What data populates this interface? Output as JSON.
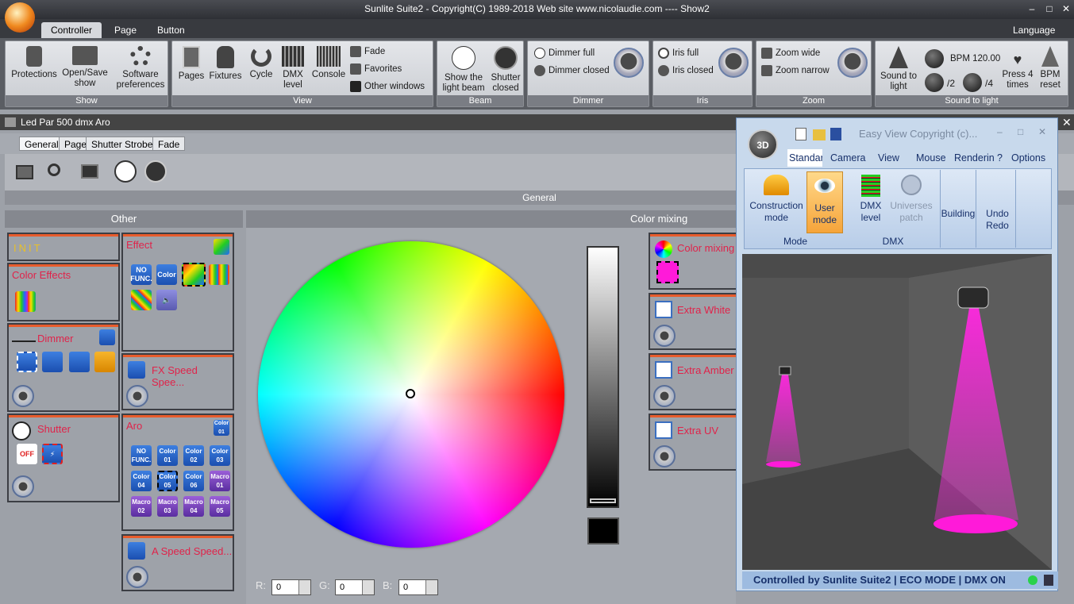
{
  "window": {
    "title": "Sunlite Suite2 - Copyright(C) 1989-2018   Web site www.nicolaudie.com ---- Show2",
    "language": "Language"
  },
  "ribbon_tabs": [
    "Controller",
    "Page",
    "Button"
  ],
  "groups": {
    "show": {
      "label": "Show",
      "protections": "Protections",
      "open_save": "Open/Save\nshow",
      "software_prefs": "Software\npreferences"
    },
    "view": {
      "label": "View",
      "pages": "Pages",
      "fixtures": "Fixtures",
      "cycle": "Cycle",
      "dmx_level": "DMX\nlevel",
      "console": "Console",
      "fade": "Fade",
      "favorites": "Favorites",
      "other_windows": "Other windows"
    },
    "beam": {
      "label": "Beam",
      "show_light_beam": "Show the\nlight beam",
      "shutter_closed": "Shutter\nclosed"
    },
    "dimmer": {
      "label": "Dimmer",
      "full": "Dimmer full",
      "closed": "Dimmer closed"
    },
    "iris": {
      "label": "Iris",
      "full": "Iris full",
      "closed": "Iris closed"
    },
    "zoom": {
      "label": "Zoom",
      "wide": "Zoom wide",
      "narrow": "Zoom narrow"
    },
    "sound": {
      "label": "Sound to light",
      "sound_to_light": "Sound to\nlight",
      "bpm": "BPM 120.00",
      "div2": "/2",
      "div4": "/4",
      "press4": "Press 4\ntimes",
      "bpm_reset": "BPM\nreset"
    }
  },
  "fixture": {
    "name": "Led Par 500 dmx Aro"
  },
  "subtabs": [
    "General",
    "Page",
    "Shutter Strobe",
    "Fade"
  ],
  "headers": {
    "general": "General",
    "other": "Other",
    "color_mixing": "Color mixing"
  },
  "panels": {
    "init": "INIT",
    "color_effects": "Color Effects",
    "dimmer": "Dimmer",
    "shutter": "Shutter",
    "effect": "Effect",
    "fx_speed": "FX Speed Spee...",
    "aro": "Aro",
    "a_speed": "A Speed Speed...",
    "color_mixing": "Color mixing",
    "extra_white": "Extra White",
    "extra_amber": "Extra Amber",
    "extra_uv": "Extra UV"
  },
  "effect_buttons": [
    "NO\nFUNC.",
    "Color",
    "",
    "",
    "",
    ""
  ],
  "aro_buttons": [
    "NO\nFUNC.",
    "Color\n01",
    "Color\n02",
    "Color\n03",
    "Color\n04",
    "Color\n05",
    "Color\n06",
    "Macro\n01",
    "Macro\n02",
    "Macro\n03",
    "Macro\n04",
    "Macro\n05"
  ],
  "aro_badge": "Color\n01",
  "shutter_off": "OFF",
  "rgb": {
    "r_label": "R:",
    "g_label": "G:",
    "b_label": "B:",
    "r": "0",
    "g": "0",
    "b": "0"
  },
  "easyview": {
    "title": "Easy View   Copyright (c)...",
    "tabs": [
      "Standard",
      "Camera",
      "View",
      "Mouse",
      "Renderin"
    ],
    "options": "Options",
    "help": "?",
    "construction": "Construction\nmode",
    "user_mode": "User\nmode",
    "mode_label": "Mode",
    "dmx_level": "DMX\nlevel",
    "universes": "Universes\npatch",
    "dmx_label": "DMX",
    "building": "Building",
    "undo_redo": "Undo\nRedo",
    "status": "Controlled by Sunlite Suite2  |  ECO MODE  |  DMX ON"
  },
  "colors": {
    "accent": "#e0234a",
    "magenta": "#ff1ad9",
    "ribbon_bg": "#5a5d63"
  }
}
